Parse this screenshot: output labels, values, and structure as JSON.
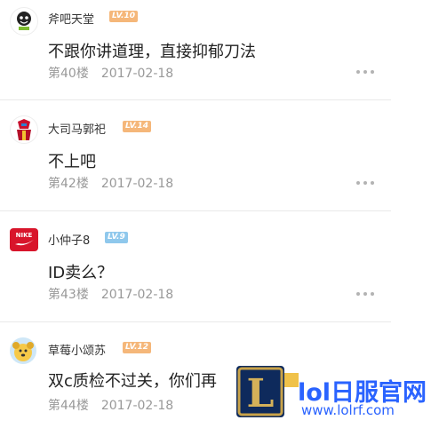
{
  "posts": [
    {
      "username": "斧吧天堂",
      "level": "LV.10",
      "level_color": "#f5b77a",
      "content": "不跟你讲道理，直接抑郁刀法",
      "floor": "第40楼",
      "date": "2017-02-18",
      "avatar_icon": "smiley-cartoon-avatar"
    },
    {
      "username": "大司马郭祀",
      "level": "LV.14",
      "level_color": "#f5b77a",
      "content": "不上吧",
      "floor": "第42楼",
      "date": "2017-02-18",
      "avatar_icon": "armored-hero-avatar"
    },
    {
      "username": "小仲子8",
      "level": "LV.9",
      "level_color": "#8fc8ec",
      "content": "ID卖么？",
      "floor": "第43楼",
      "date": "2017-02-18",
      "avatar_icon": "nike-sb-logo-avatar"
    },
    {
      "username": "草莓小颂苏",
      "level": "LV.12",
      "level_color": "#f5b77a",
      "content": "双c质检不过关，你们再",
      "floor": "第44楼",
      "date": "2017-02-18",
      "avatar_icon": "yellow-dog-avatar"
    }
  ],
  "watermark": {
    "brand": "lol日服官网",
    "url": "www.lolrf.com",
    "logo_letter": "L",
    "icon": "league-of-legends-logo"
  }
}
